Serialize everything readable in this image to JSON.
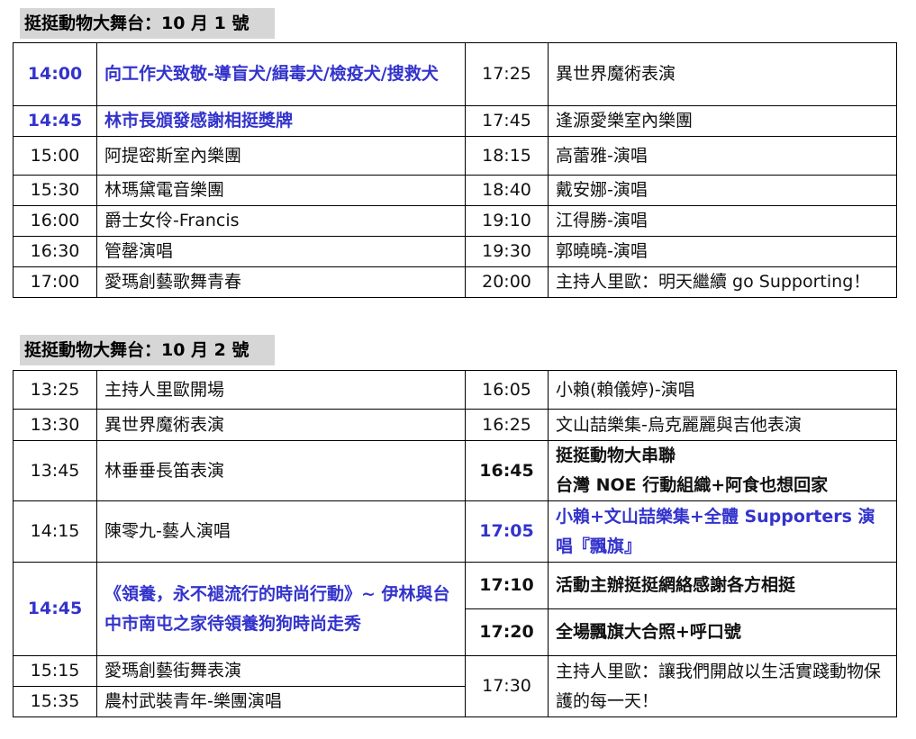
{
  "day1": {
    "heading": "挺挺動物大舞台：10 月 1 號",
    "rows": [
      {
        "t1": "14:00",
        "e1": "向工作犬致敬-導盲犬/緝毒犬/檢疫犬/搜救犬",
        "t2": "17:25",
        "e2": "異世界魔術表演"
      },
      {
        "t1": "14:45",
        "e1": "林市長頒發感謝相挺獎牌",
        "t2": "17:45",
        "e2": "逢源愛樂室內樂團"
      },
      {
        "t1": "15:00",
        "e1": "阿提密斯室內樂團",
        "t2": "18:15",
        "e2": "高蕾雅-演唱"
      },
      {
        "t1": "15:30",
        "e1": "林瑪黛電音樂團",
        "t2": "18:40",
        "e2": "戴安娜-演唱"
      },
      {
        "t1": "16:00",
        "e1": "爵士女伶-Francis",
        "t2": "19:10",
        "e2": "江得勝-演唱"
      },
      {
        "t1": "16:30",
        "e1": "管罄演唱",
        "t2": "19:30",
        "e2": "郭曉曉-演唱"
      },
      {
        "t1": "17:00",
        "e1": "愛瑪創藝歌舞青春",
        "t2": "20:00",
        "e2": "主持人里歐：明天繼續 go Supporting！"
      }
    ]
  },
  "day2": {
    "heading": "挺挺動物大舞台：10 月 2 號",
    "r1": {
      "t1": "13:25",
      "e1": "主持人里歐開場",
      "t2": "16:05",
      "e2": "小賴(賴儀婷)-演唱"
    },
    "r2": {
      "t1": "13:30",
      "e1": "異世界魔術表演",
      "t2": "16:25",
      "e2": "文山喆樂集-烏克麗麗與吉他表演"
    },
    "r3": {
      "t1": "13:45",
      "e1": "林垂垂長笛表演",
      "t2": "16:45",
      "e2a": "挺挺動物大串聯",
      "e2b": "台灣 NOE 行動組織+阿食也想回家"
    },
    "r4": {
      "t1": "14:15",
      "e1": "陳零九-藝人演唱",
      "t2": "17:05",
      "e2": "小賴+文山喆樂集+全體 Supporters 演唱『飄旗』"
    },
    "r5": {
      "t1": "14:45",
      "e1": "《領養，永不褪流行的時尚行動》~ 伊林與台中市南屯之家待領養狗狗時尚走秀",
      "t2a": "17:10",
      "e2a": "活動主辦挺挺網絡感謝各方相挺",
      "t2b": "17:20",
      "e2b": "全場飄旗大合照+呼口號"
    },
    "r6": {
      "t1a": "15:15",
      "e1a": "愛瑪創藝街舞表演",
      "t1b": "15:35",
      "e1b": "農村武裝青年-樂團演唱",
      "t2": "17:30",
      "e2": "主持人里歐：讓我們開啟以生活實踐動物保護的每一天！"
    }
  }
}
